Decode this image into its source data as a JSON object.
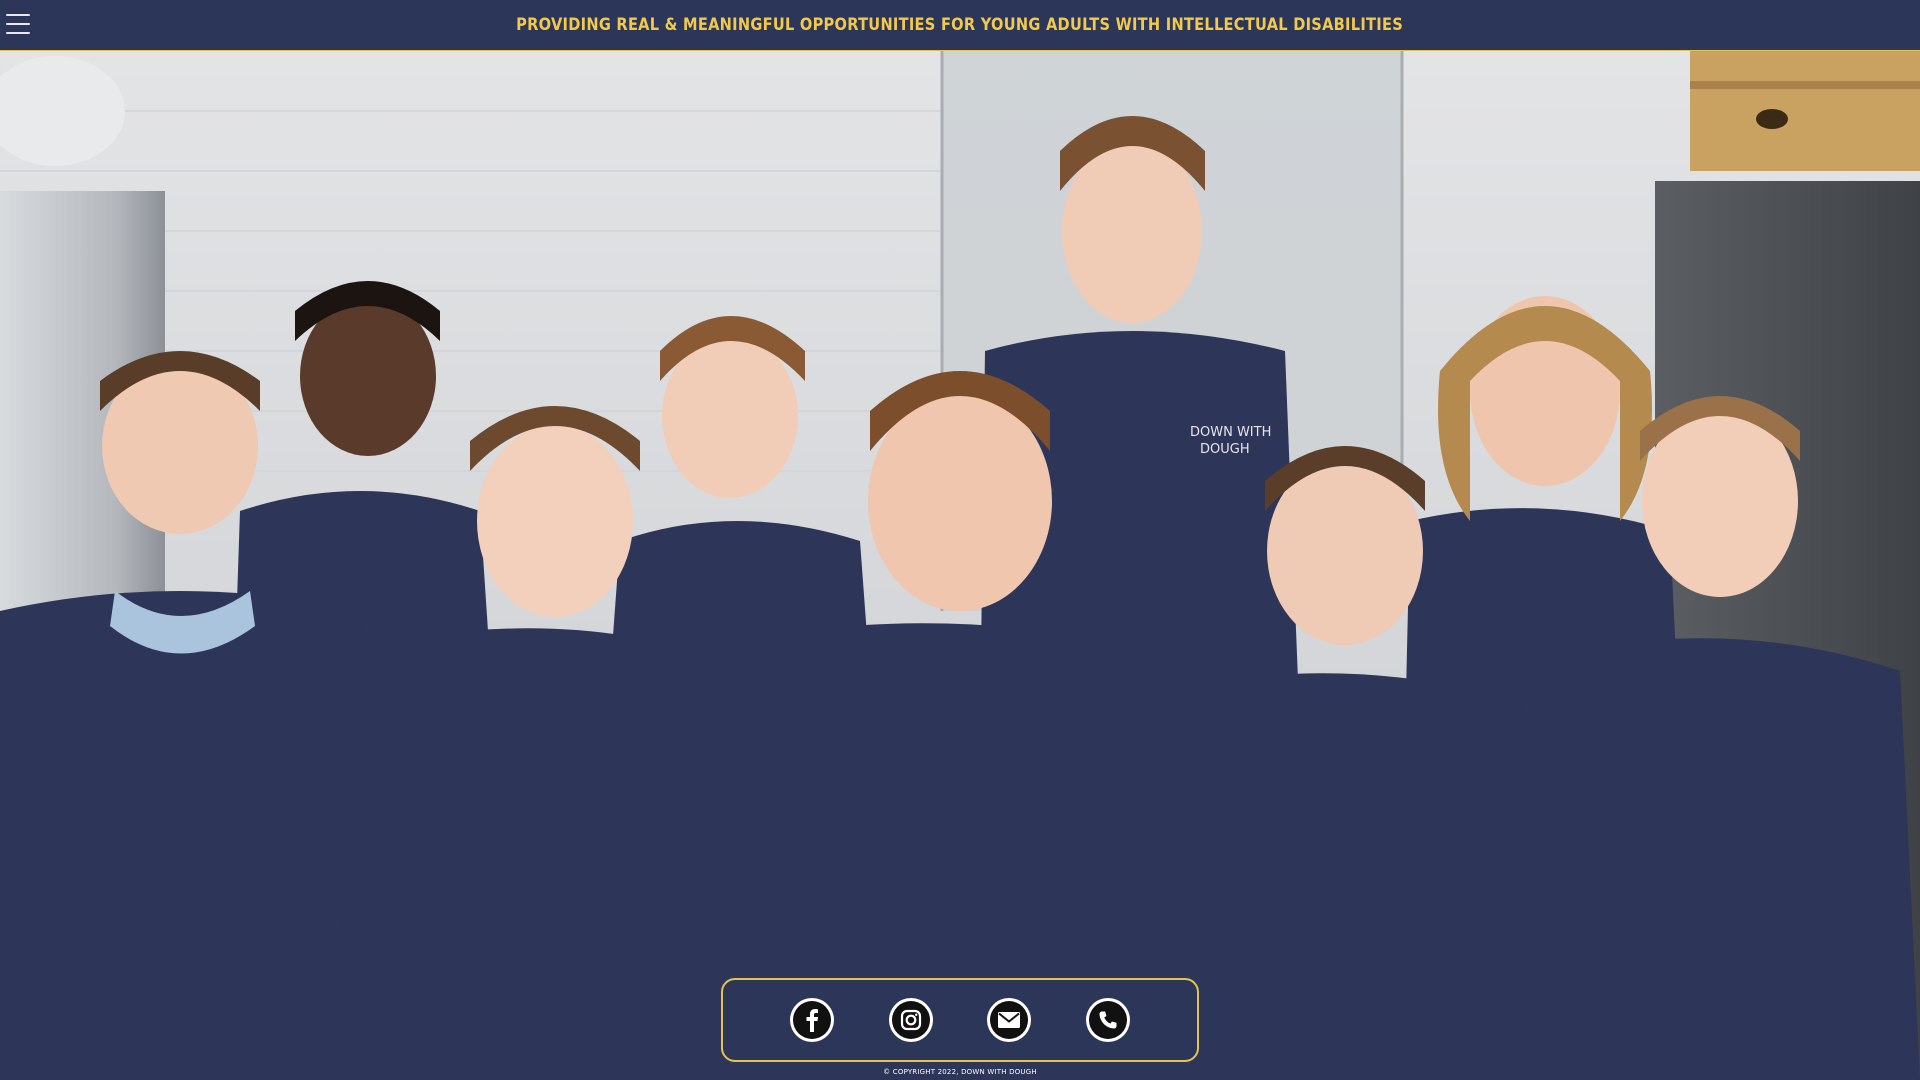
{
  "header": {
    "menu_icon": "hamburger-menu-icon",
    "tagline": "PROVIDING REAL & MEANINGFUL OPPORTUNITIES FOR YOUNG ADULTS WITH INTELLECTUAL DISABILITIES"
  },
  "hero": {
    "shirt_print_line1": "DOWN WITH",
    "shirt_print_line2": "DOUGH"
  },
  "social": {
    "items": [
      {
        "icon": "facebook-icon"
      },
      {
        "icon": "instagram-icon"
      },
      {
        "icon": "email-icon"
      },
      {
        "icon": "phone-icon"
      }
    ]
  },
  "footer": {
    "copyright": "© COPYRIGHT 2022, DOWN WITH DOUGH"
  },
  "colors": {
    "bar": "#2b3658",
    "accent": "#e6c34f",
    "tagline": "#f2c94c",
    "shirt": "#2d3559"
  }
}
